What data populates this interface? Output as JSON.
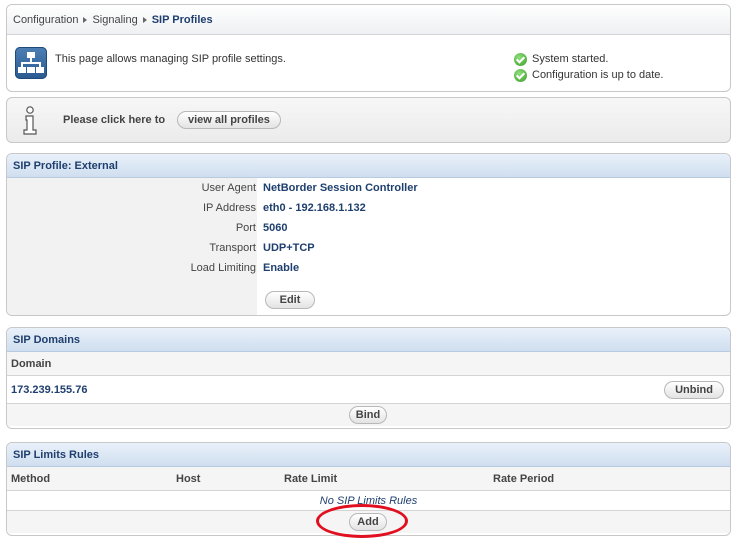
{
  "breadcrumb": {
    "items": [
      "Configuration",
      "Signaling"
    ],
    "current": "SIP Profiles"
  },
  "intro": {
    "text": "This page allows managing SIP profile settings.",
    "icon": "network-icon"
  },
  "status": {
    "lines": [
      "System started.",
      "Configuration is up to date."
    ],
    "color": "#3a9a2a"
  },
  "hint": {
    "text": "Please click here to",
    "button_label": "view all profiles"
  },
  "profile": {
    "title": "SIP Profile: External",
    "rows": [
      {
        "label": "User Agent",
        "value": "NetBorder Session Controller"
      },
      {
        "label": "IP Address",
        "value": "eth0 - 192.168.1.132"
      },
      {
        "label": "Port",
        "value": "5060"
      },
      {
        "label": "Transport",
        "value": "UDP+TCP"
      },
      {
        "label": "Load Limiting",
        "value": "Enable"
      }
    ],
    "edit_label": "Edit"
  },
  "domains": {
    "title": "SIP Domains",
    "column": "Domain",
    "rows": [
      {
        "domain": "173.239.155.76",
        "action": "Unbind"
      }
    ],
    "bind_label": "Bind"
  },
  "limits": {
    "title": "SIP Limits Rules",
    "columns": [
      "Method",
      "Host",
      "Rate Limit",
      "Rate Period"
    ],
    "empty_text": "No SIP Limits Rules",
    "add_label": "Add"
  },
  "colors": {
    "accent": "#1f3f6e",
    "highlight": "#e01020"
  }
}
